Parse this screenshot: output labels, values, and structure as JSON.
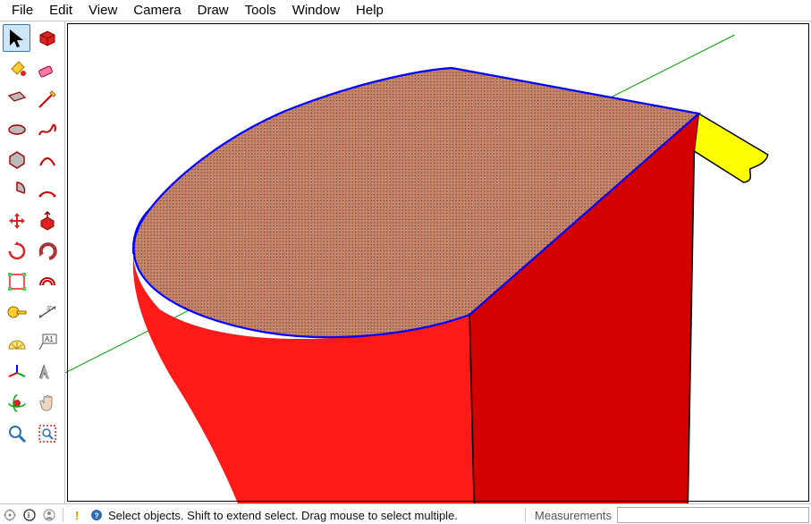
{
  "menu": {
    "items": [
      "File",
      "Edit",
      "View",
      "Camera",
      "Draw",
      "Tools",
      "Window",
      "Help"
    ]
  },
  "tools": [
    {
      "name": "select-tool",
      "active": true
    },
    {
      "name": "make-component-tool",
      "active": false
    },
    {
      "name": "paint-bucket-tool",
      "active": false
    },
    {
      "name": "eraser-tool",
      "active": false
    },
    {
      "name": "rectangle-tool",
      "active": false
    },
    {
      "name": "line-tool",
      "active": false
    },
    {
      "name": "circle-tool",
      "active": false
    },
    {
      "name": "freehand-tool",
      "active": false
    },
    {
      "name": "polygon-tool",
      "active": false
    },
    {
      "name": "arc-tool",
      "active": false
    },
    {
      "name": "pie-tool",
      "active": false
    },
    {
      "name": "two-point-arc-tool",
      "active": false
    },
    {
      "name": "move-tool",
      "active": false
    },
    {
      "name": "push-pull-tool",
      "active": false
    },
    {
      "name": "rotate-tool",
      "active": false
    },
    {
      "name": "follow-me-tool",
      "active": false
    },
    {
      "name": "scale-tool",
      "active": false
    },
    {
      "name": "offset-tool",
      "active": false
    },
    {
      "name": "tape-measure-tool",
      "active": false
    },
    {
      "name": "dimension-tool",
      "active": false
    },
    {
      "name": "protractor-tool",
      "active": false
    },
    {
      "name": "text-tool",
      "active": false
    },
    {
      "name": "axes-tool",
      "active": false
    },
    {
      "name": "3d-text-tool",
      "active": false
    },
    {
      "name": "orbit-tool",
      "active": false
    },
    {
      "name": "pan-tool",
      "active": false
    },
    {
      "name": "zoom-tool",
      "active": false
    },
    {
      "name": "zoom-window-tool",
      "active": false
    }
  ],
  "status": {
    "hint": "Select objects. Shift to extend select. Drag mouse to select multiple.",
    "measurements_label": "Measurements",
    "measurements_value": ""
  },
  "colors": {
    "model_side": "#ff0000",
    "model_side_shadow": "#c90000",
    "selection_blue": "#0000ff",
    "top_face_fill": "#b86850",
    "follow_me_profile": "#ffff00",
    "axis_green": "#00a000"
  }
}
